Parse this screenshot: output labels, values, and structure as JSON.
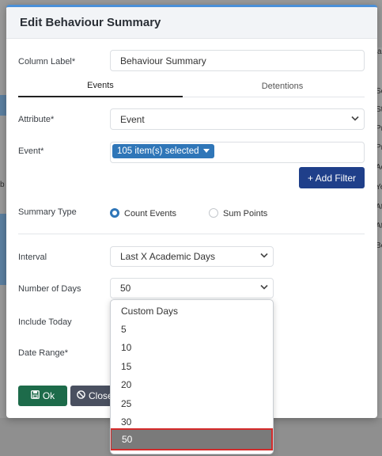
{
  "modal": {
    "title": "Edit Behaviour Summary",
    "column_label": {
      "label": "Column Label*",
      "value": "Behaviour Summary"
    },
    "tabs": [
      {
        "label": "Events",
        "active": true
      },
      {
        "label": "Detentions",
        "active": false
      }
    ],
    "attribute": {
      "label": "Attribute*",
      "value": "Event"
    },
    "event": {
      "label": "Event*",
      "chip": "105 item(s) selected"
    },
    "add_filter_label": "+ Add Filter",
    "summary_type": {
      "label": "Summary Type",
      "options": [
        {
          "label": "Count Events",
          "selected": true
        },
        {
          "label": "Sum Points",
          "selected": false
        }
      ]
    },
    "interval": {
      "label": "Interval",
      "value": "Last X Academic Days"
    },
    "number_of_days": {
      "label": "Number of Days",
      "value": "50"
    },
    "include_today_label": "Include Today",
    "date_range_label": "Date Range*",
    "ok_label": "Ok",
    "close_label": "Close"
  },
  "dropdown": {
    "options": [
      "Custom Days",
      "5",
      "10",
      "15",
      "20",
      "25",
      "30",
      "50"
    ],
    "selected": "50"
  },
  "background": {
    "fragments": [
      "a",
      "Sc",
      "St",
      "Pr",
      "Pr",
      "Ac",
      "Ye",
      "At",
      "At",
      "Be",
      "b"
    ]
  },
  "colors": {
    "accent": "#2f76b8",
    "add_filter": "#1f3f8a",
    "ok": "#1d6b4a",
    "close": "#4a5060",
    "highlight_border": "#d32b2b"
  }
}
